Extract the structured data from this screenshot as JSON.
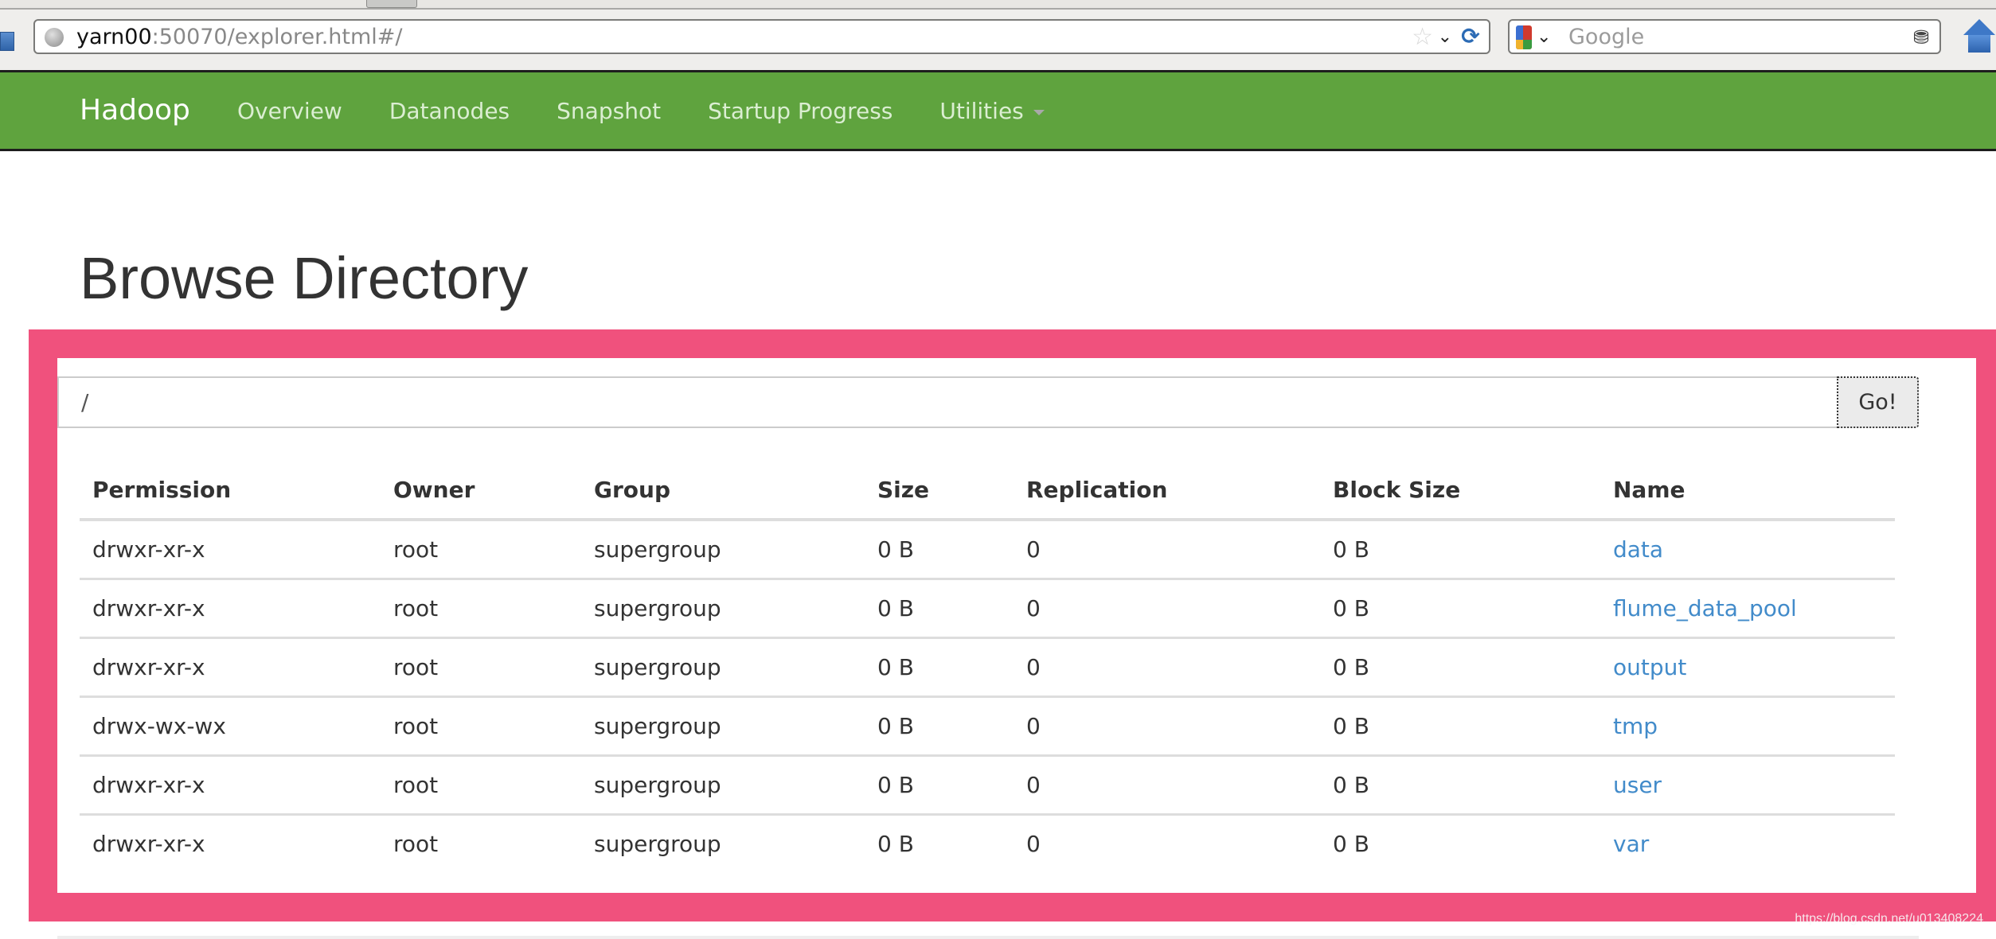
{
  "browser": {
    "url_host": "yarn00",
    "url_rest": ":50070/explorer.html#/",
    "search_placeholder": "Google",
    "icons": {
      "globe": "globe-icon",
      "bookmark": "star-icon",
      "dropdown": "chevron-down-icon",
      "reload": "reload-icon",
      "search_engine": "google-icon",
      "search": "binoculars-icon",
      "home": "home-icon"
    },
    "glyphs": {
      "star": "☆",
      "chevron": "⌄",
      "reload": "⟳",
      "binoculars": "⛃"
    }
  },
  "navbar": {
    "brand": "Hadoop",
    "links": [
      {
        "label": "Overview"
      },
      {
        "label": "Datanodes"
      },
      {
        "label": "Snapshot"
      },
      {
        "label": "Startup Progress"
      },
      {
        "label": "Utilities",
        "has_dropdown": true
      }
    ],
    "colors": {
      "background": "#5fa33e",
      "link": "#dbeed2",
      "brand": "#ffffff"
    }
  },
  "page": {
    "title": "Browse Directory",
    "path_input_value": "/",
    "go_label": "Go!"
  },
  "table": {
    "columns": [
      "Permission",
      "Owner",
      "Group",
      "Size",
      "Replication",
      "Block Size",
      "Name"
    ],
    "rows": [
      {
        "permission": "drwxr-xr-x",
        "owner": "root",
        "group": "supergroup",
        "size": "0 B",
        "replication": "0",
        "block_size": "0 B",
        "name": "data"
      },
      {
        "permission": "drwxr-xr-x",
        "owner": "root",
        "group": "supergroup",
        "size": "0 B",
        "replication": "0",
        "block_size": "0 B",
        "name": "flume_data_pool"
      },
      {
        "permission": "drwxr-xr-x",
        "owner": "root",
        "group": "supergroup",
        "size": "0 B",
        "replication": "0",
        "block_size": "0 B",
        "name": "output"
      },
      {
        "permission": "drwx-wx-wx",
        "owner": "root",
        "group": "supergroup",
        "size": "0 B",
        "replication": "0",
        "block_size": "0 B",
        "name": "tmp"
      },
      {
        "permission": "drwxr-xr-x",
        "owner": "root",
        "group": "supergroup",
        "size": "0 B",
        "replication": "0",
        "block_size": "0 B",
        "name": "user"
      },
      {
        "permission": "drwxr-xr-x",
        "owner": "root",
        "group": "supergroup",
        "size": "0 B",
        "replication": "0",
        "block_size": "0 B",
        "name": "var"
      }
    ],
    "link_color": "#428bca"
  },
  "annotation": {
    "highlight_color": "#f0517d"
  },
  "watermark": "https://blog.csdn.net/u013408224"
}
